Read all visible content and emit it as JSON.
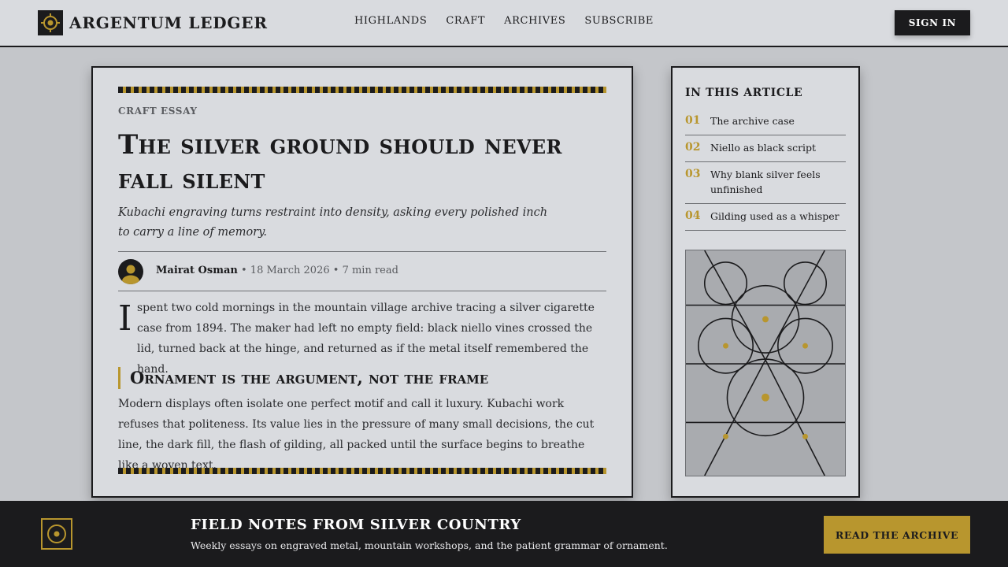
{
  "header": {
    "brand": "ARGENTUM LEDGER",
    "nav": [
      "HIGHLANDS",
      "CRAFT",
      "ARCHIVES",
      "SUBSCRIBE"
    ],
    "sign_in": "SIGN IN"
  },
  "article": {
    "kicker": "CRAFT ESSAY",
    "title": "The silver ground should never fall silent",
    "dek": "Kubachi engraving turns restraint into density, asking every polished inch to carry a line of memory.",
    "author": "Mairat Osman",
    "date": "18 March 2026",
    "read_time": "7 min read",
    "separator": "•",
    "dropcap": "I",
    "lead": "spent two cold mornings in the mountain village archive tracing a silver cigarette case from 1894. The maker had left no empty field: black niello vines crossed the lid, turned back at the hinge, and returned as if the metal itself remembered the hand.",
    "subhead": "Ornament is the argument, not the frame",
    "body": "Modern displays often isolate one perfect motif and call it luxury. Kubachi work refuses that politeness. Its value lies in the pressure of many small decisions, the cut line, the dark fill, the flash of gilding, all packed until the surface begins to breathe like a woven text."
  },
  "toc": {
    "heading": "IN THIS ARTICLE",
    "items": [
      {
        "num": "01",
        "label": "The archive case"
      },
      {
        "num": "02",
        "label": "Niello as black script"
      },
      {
        "num": "03",
        "label": "Why blank silver feels unfinished"
      },
      {
        "num": "04",
        "label": "Gilding used as a whisper"
      }
    ]
  },
  "banner": {
    "title": "FIELD NOTES FROM SILVER COUNTRY",
    "text": "Weekly essays on engraved metal, mountain workshops, and the patient grammar of ornament.",
    "cta": "READ THE ARCHIVE"
  },
  "colors": {
    "ink": "#1b1b1d",
    "gold": "#b8962e",
    "paper": "#d9dbdf",
    "page": "#c4c6ca"
  },
  "icons": {
    "brand": "crosshair-medallion-icon",
    "avatar": "user-avatar-icon",
    "banner": "ring-medallion-icon"
  }
}
